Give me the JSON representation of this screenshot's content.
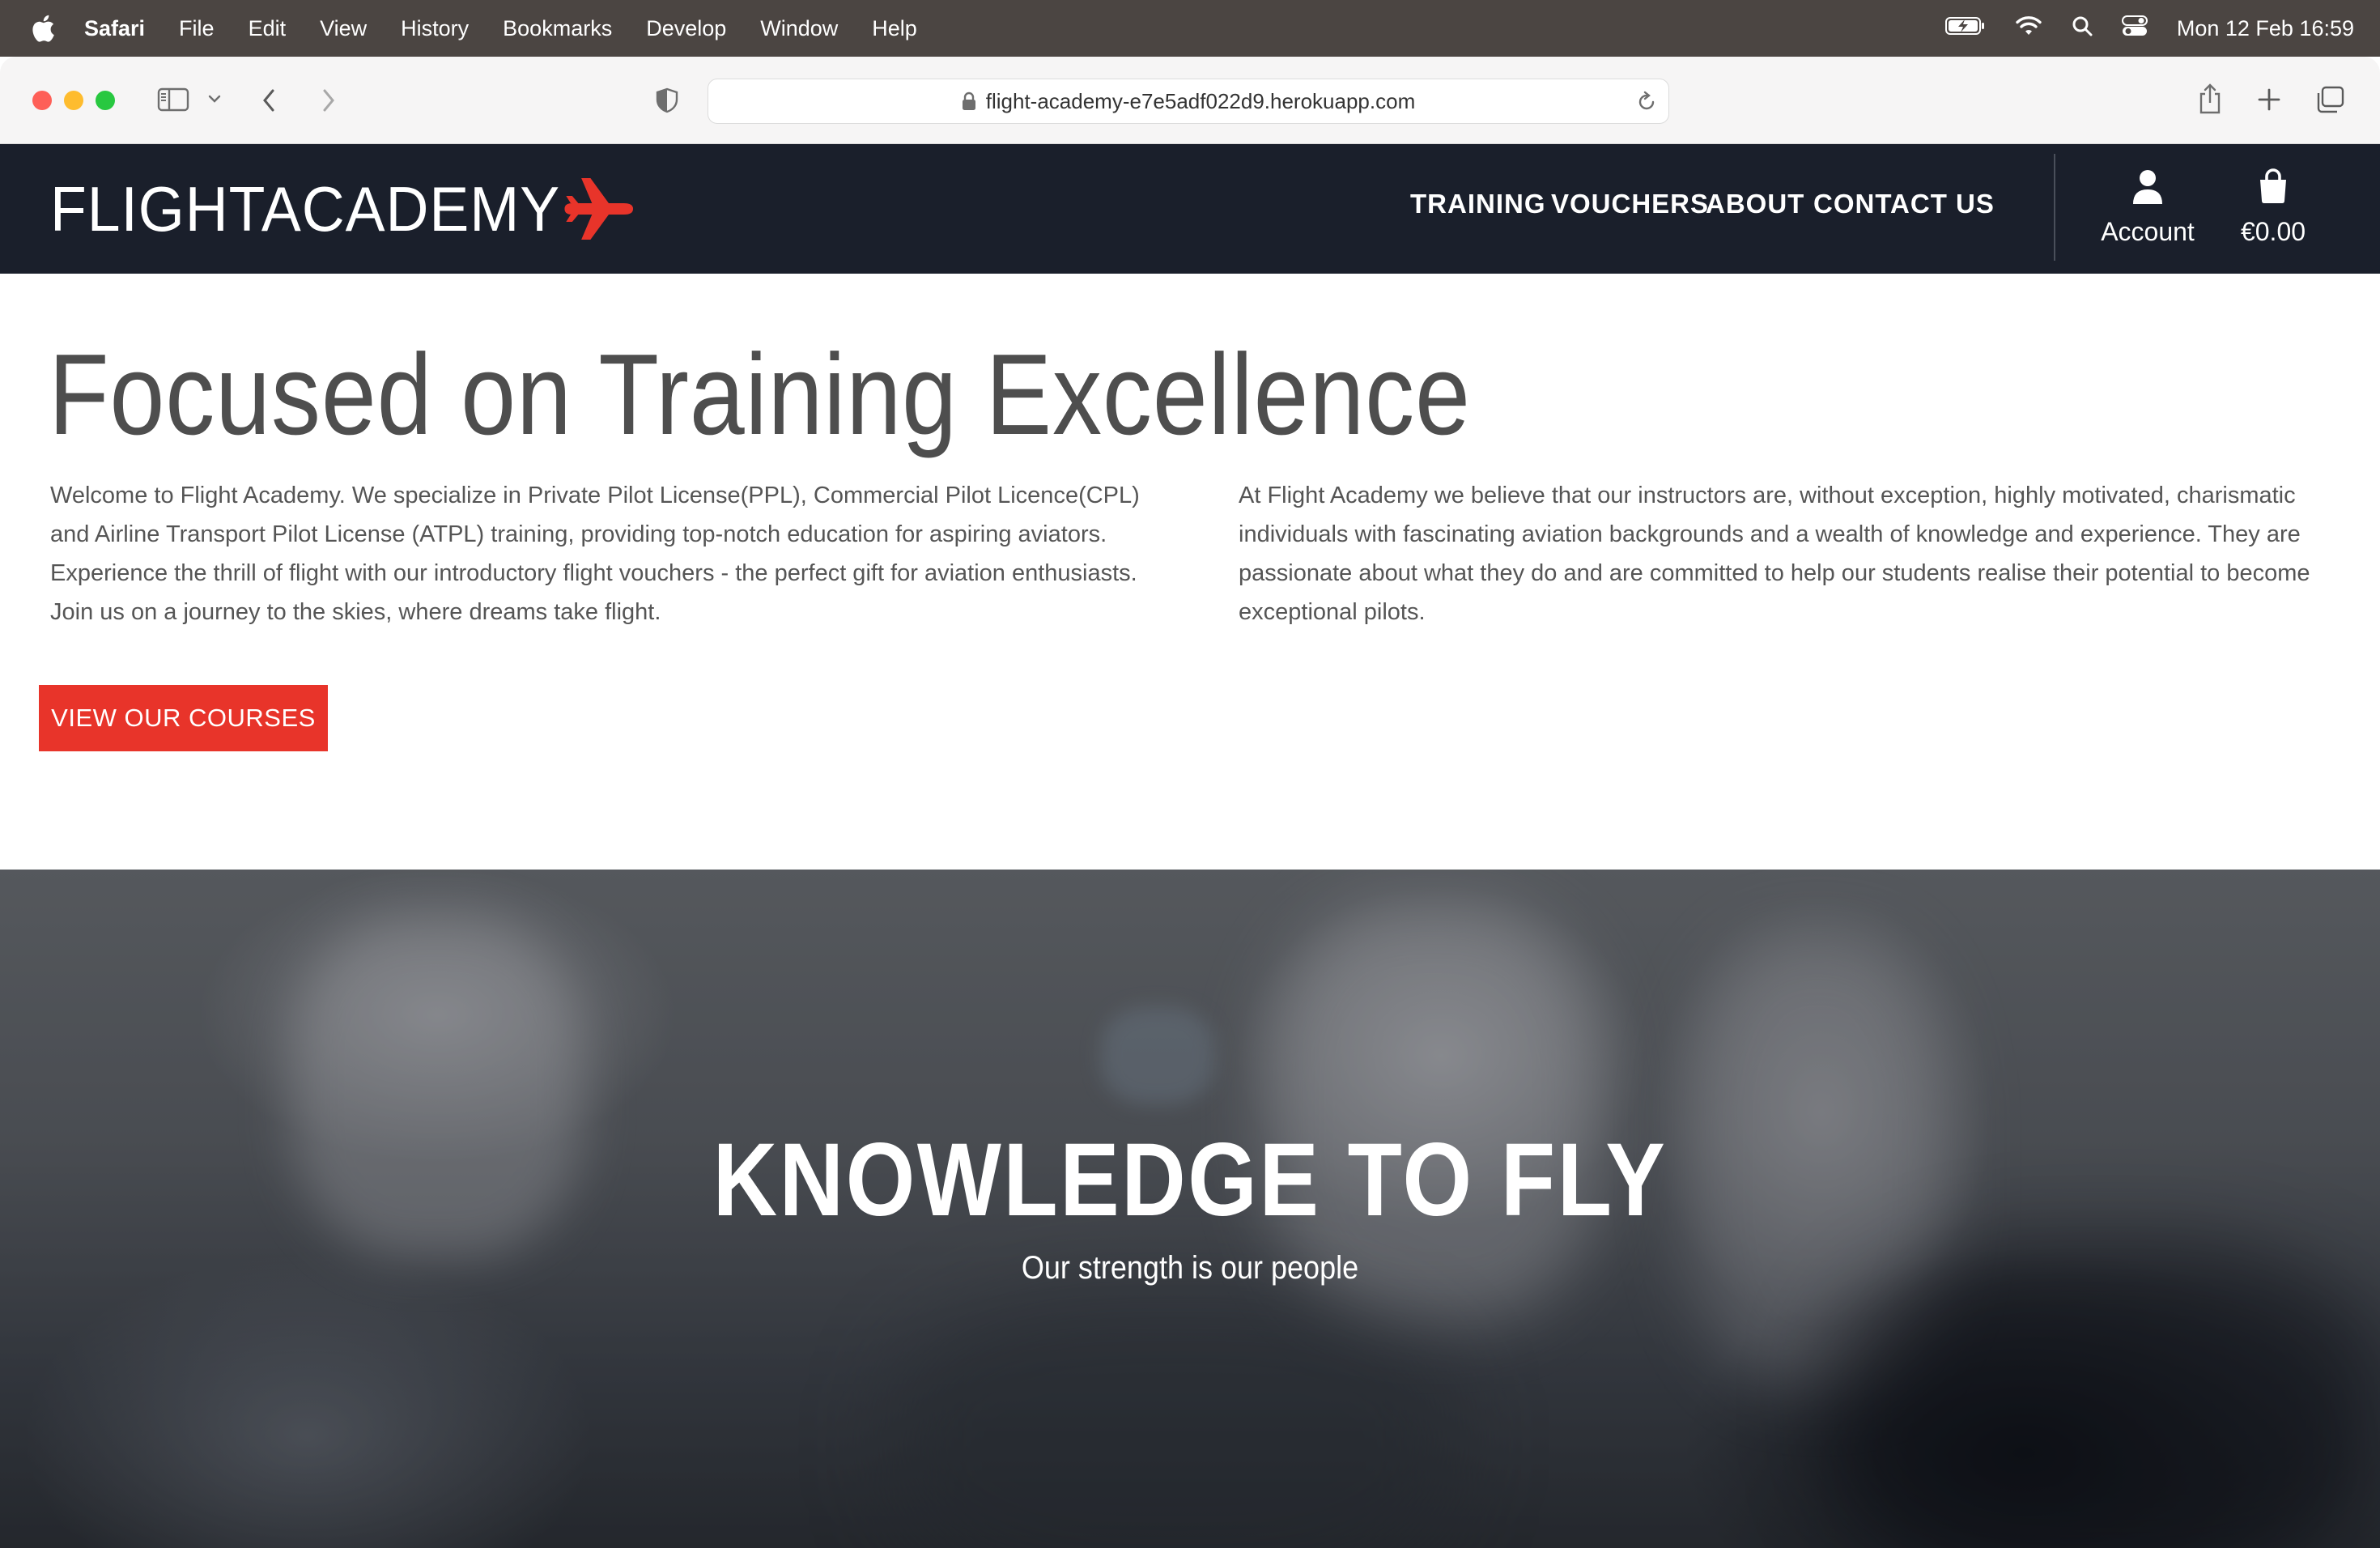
{
  "menubar": {
    "app": "Safari",
    "items": [
      "File",
      "Edit",
      "View",
      "History",
      "Bookmarks",
      "Develop",
      "Window",
      "Help"
    ],
    "clock": "Mon 12 Feb  16:59"
  },
  "browser": {
    "url": "flight-academy-e7e5adf022d9.herokuapp.com"
  },
  "site": {
    "logo_text": "FLIGHTACADEMY",
    "nav": [
      "TRAINING",
      "VOUCHERS",
      "ABOUT",
      "CONTACT US"
    ],
    "account_label": "Account",
    "cart_total": "€0.00",
    "brand_color": "#e8342a",
    "header_color": "#1a1f2b"
  },
  "intro": {
    "headline": "Focused on Training Excellence",
    "left_paragraph": "Welcome to Flight Academy. We specialize in Private Pilot License(PPL), Commercial Pilot Licence(CPL) and Airline Transport Pilot License (ATPL) training, providing top-notch education for aspiring aviators. Experience the thrill of flight with our introductory flight vouchers - the perfect gift for aviation enthusiasts. Join us on a journey to the skies, where dreams take flight.",
    "right_paragraph": "At Flight Academy we believe that our instructors are, without exception, highly motivated, charismatic individuals with fascinating aviation backgrounds and a wealth of knowledge and experience. They are passionate about what they do and are committed to help our students realise their potential to become exceptional pilots.",
    "cta_label": "VIEW OUR COURSES"
  },
  "hero": {
    "title": "KNOWLEDGE TO FLY",
    "subtitle": "Our strength is our people"
  }
}
